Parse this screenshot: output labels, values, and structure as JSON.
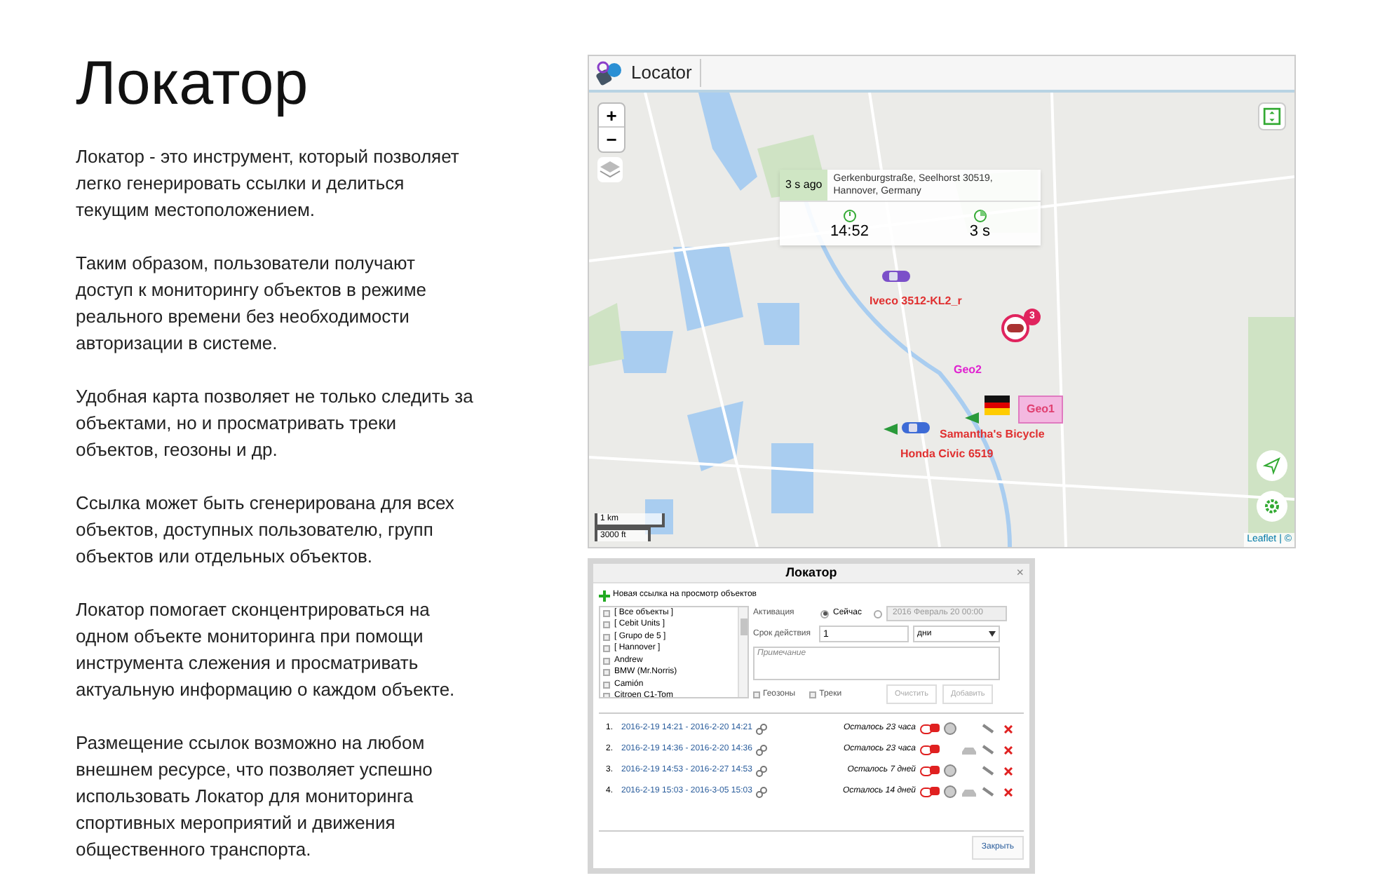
{
  "heading": "Локатор",
  "paragraphs": [
    "Локатор - это инструмент, который позволяет легко генерировать ссылки и делиться текущим местоположением.",
    "Таким образом, пользователи получают доступ к мониторингу объектов в режиме реального времени без необходимости авторизации в системе.",
    "Удобная карта позволяет не только следить за объектами, но и просматривать треки объектов, геозоны и др.",
    "Ссылка может быть сгенерирована для всех объектов, доступных пользователю, групп объектов или отдельных объектов.",
    "Локатор помогает сконцентрироваться на одном объекте мониторинга при помощи инструмента слежения и просматривать актуальную информацию о каждом объекте.",
    "Размещение ссылок возможно на любом внешнем ресурсе, что позволяет успешно использовать Локатор для мониторинга спортивных мероприятий и движения общественного транспорта."
  ],
  "app": {
    "title": "Locator",
    "map": {
      "zoom_in": "+",
      "zoom_out": "−",
      "popup": {
        "ago": "3 s ago",
        "address": "Gerkenburgstraße, Seelhorst 30519, Hannover, Germany",
        "time": "14:52",
        "duration": "3 s"
      },
      "markers": [
        {
          "kind": "car",
          "label": "Iveco 3512-KL2_r",
          "color": "#7b4fc9"
        },
        {
          "kind": "cluster",
          "label": "3",
          "color": "#e0245e"
        },
        {
          "kind": "geozone",
          "label": "Geo2",
          "color": "#e020d0"
        },
        {
          "kind": "flag"
        },
        {
          "kind": "geozone",
          "label": "Geo1",
          "color": "#e04070"
        },
        {
          "kind": "car",
          "label": "Samantha's Bicycle",
          "color": "#3d6bd6"
        },
        {
          "kind": "label",
          "label": "Honda Civic 6519",
          "color": "#e03030"
        }
      ],
      "scale": [
        "1 km",
        "3000 ft"
      ],
      "attribution": "Leaflet | ©"
    }
  },
  "dialog": {
    "title": "Локатор",
    "close": "×",
    "new_link": "Новая ссылка на просмотр объектов",
    "units": [
      {
        "label": "[ Все объекты ]",
        "checked": false
      },
      {
        "label": "[ Cebit Units ]",
        "checked": false
      },
      {
        "label": "[ Grupo de 5 ]",
        "checked": false
      },
      {
        "label": "[ Hannover ]",
        "checked": false
      },
      {
        "label": "Andrew",
        "checked": false
      },
      {
        "label": "BMW (Mr.Norris)",
        "checked": false
      },
      {
        "label": "Camión",
        "checked": false
      },
      {
        "label": "Citroen C1-Tom",
        "checked": false
      }
    ],
    "activation_label": "Активация",
    "activation": [
      {
        "label": "Сейчас",
        "selected": true
      },
      {
        "label": "2016 Февраль 20 00:00",
        "selected": false
      }
    ],
    "duration_label": "Срок действия",
    "duration_value": "1",
    "duration_unit": "дни",
    "note_placeholder": "Примечание",
    "options": [
      {
        "label": "Геозоны",
        "checked": false
      },
      {
        "label": "Треки",
        "checked": false
      }
    ],
    "clear": "Очистить",
    "add": "Добавить",
    "buttons_disabled": true,
    "links": [
      {
        "number": "1.",
        "period": "2016-2-19 14:21 - 2016-2-20 14:21",
        "remaining": "Осталось 23 часа",
        "coin": true,
        "car": false
      },
      {
        "number": "2.",
        "period": "2016-2-19 14:36 - 2016-2-20 14:36",
        "remaining": "Осталось 23 часа",
        "coin": false,
        "car": true
      },
      {
        "number": "3.",
        "period": "2016-2-19 14:53 - 2016-2-27 14:53",
        "remaining": "Осталось 7 дней",
        "coin": true,
        "car": false
      },
      {
        "number": "4.",
        "period": "2016-2-19 15:03 - 2016-3-05 15:03",
        "remaining": "Осталось 14 дней",
        "coin": true,
        "car": true
      }
    ],
    "close_button": "Закрыть"
  }
}
